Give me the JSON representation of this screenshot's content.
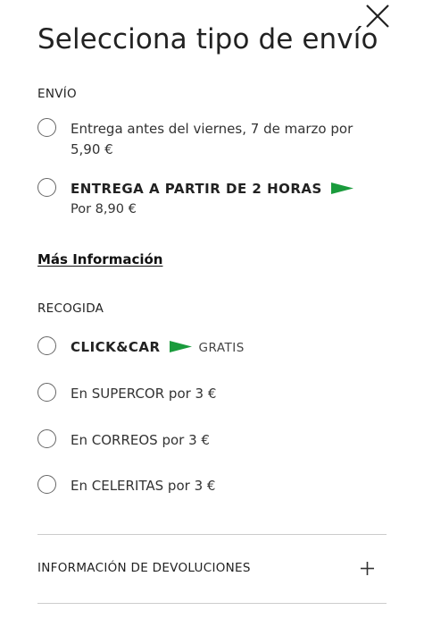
{
  "modal": {
    "title": "Selecciona tipo de envío",
    "close_icon": "close-icon"
  },
  "envio": {
    "label": "ENVÍO",
    "options": [
      {
        "text": "Entrega antes del viernes, 7 de marzo por 5,90 €"
      },
      {
        "text": "ENTREGA A PARTIR DE 2 HORAS",
        "sub": "Por 8,90 €",
        "icon": "green-flag-icon"
      }
    ],
    "more_info": "Más Información"
  },
  "recogida": {
    "label": "RECOGIDA",
    "options": [
      {
        "text": "CLICK&CAR",
        "badge": "GRATIS",
        "icon": "green-flag-icon"
      },
      {
        "text": "En SUPERCOR por 3 €"
      },
      {
        "text": "En CORREOS por 3 €"
      },
      {
        "text": "En CELERITAS por 3 €"
      }
    ]
  },
  "devoluciones": {
    "label": "INFORMACIÓN DE DEVOLUCIONES",
    "icon": "plus-icon"
  },
  "colors": {
    "flag_green": "#1a9b3c",
    "text": "#222222",
    "divider": "#cccccc"
  }
}
